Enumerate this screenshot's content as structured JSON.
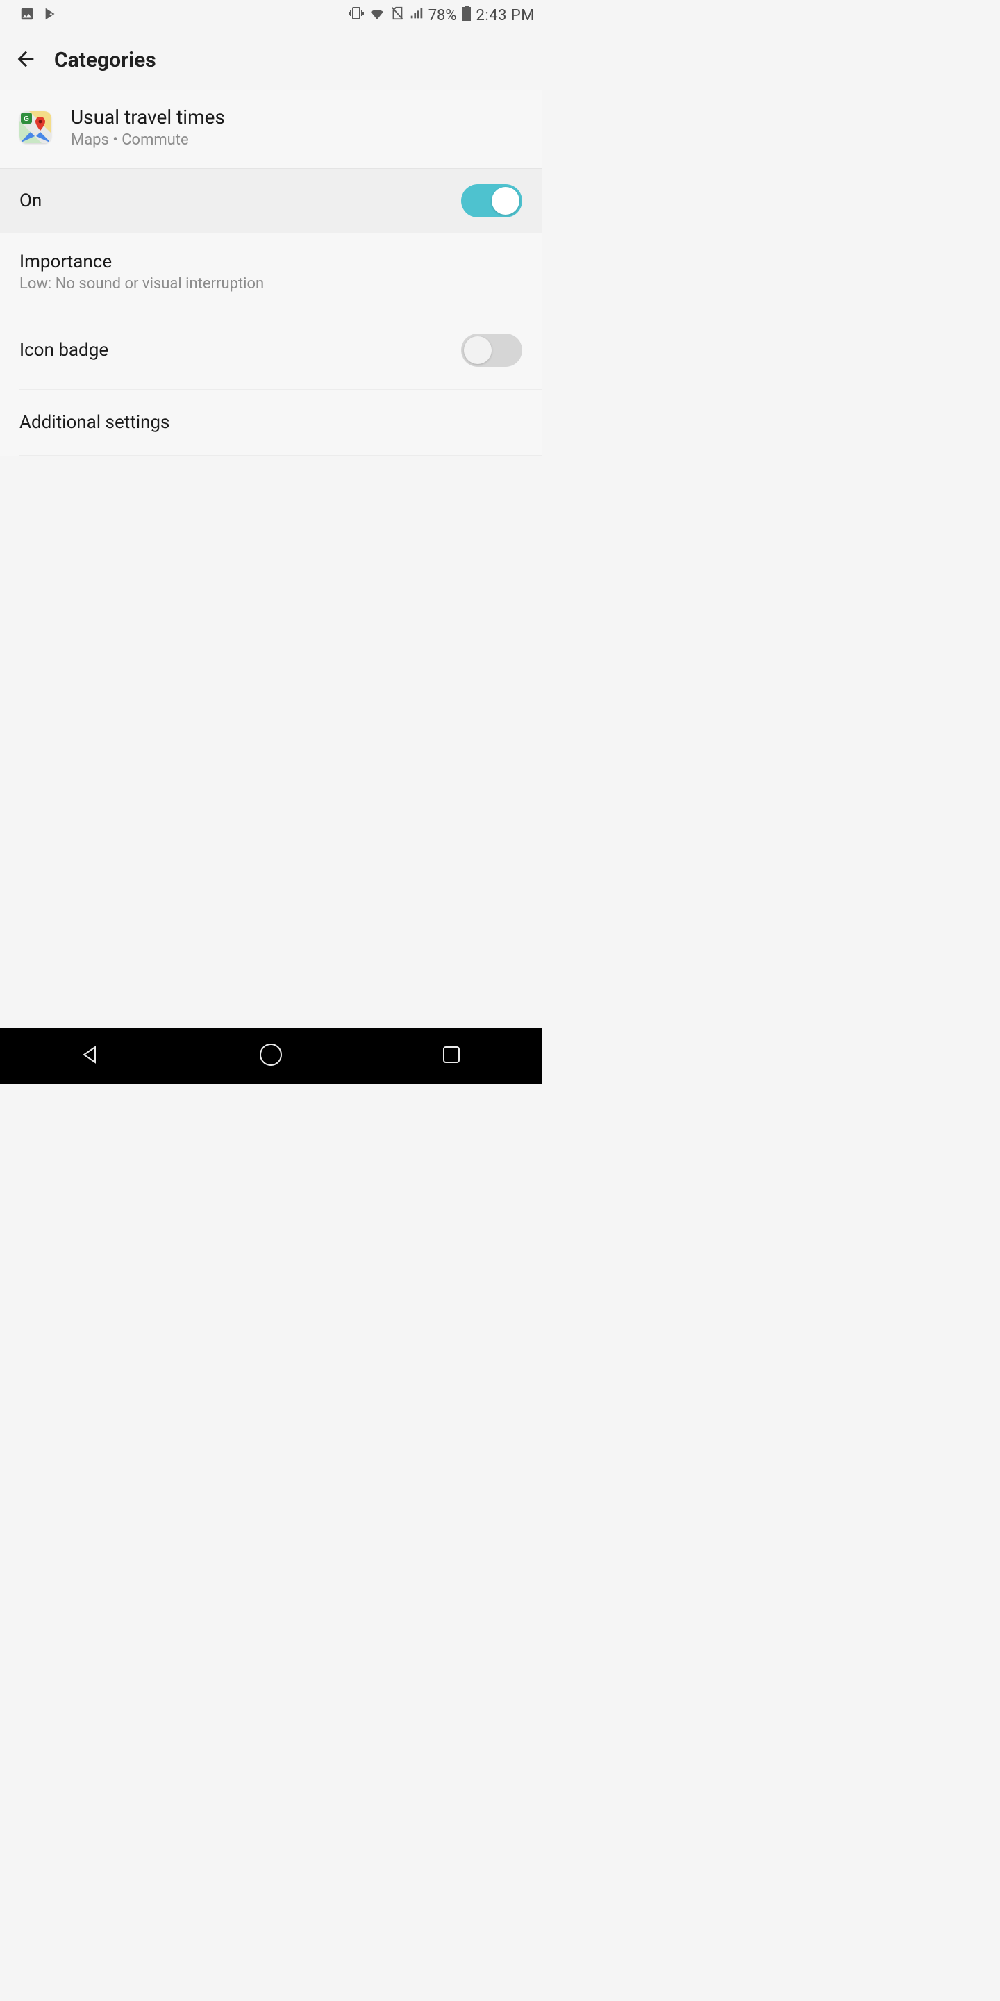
{
  "status": {
    "battery_pct": "78%",
    "time": "2:43 PM"
  },
  "appbar": {
    "title": "Categories"
  },
  "channel": {
    "title": "Usual travel times",
    "subtitle": "Maps • Commute"
  },
  "rows": {
    "on_label": "On",
    "on_state": "on",
    "importance_label": "Importance",
    "importance_value": "Low: No sound or visual interruption",
    "icon_badge_label": "Icon badge",
    "icon_badge_state": "off",
    "additional_label": "Additional settings"
  }
}
